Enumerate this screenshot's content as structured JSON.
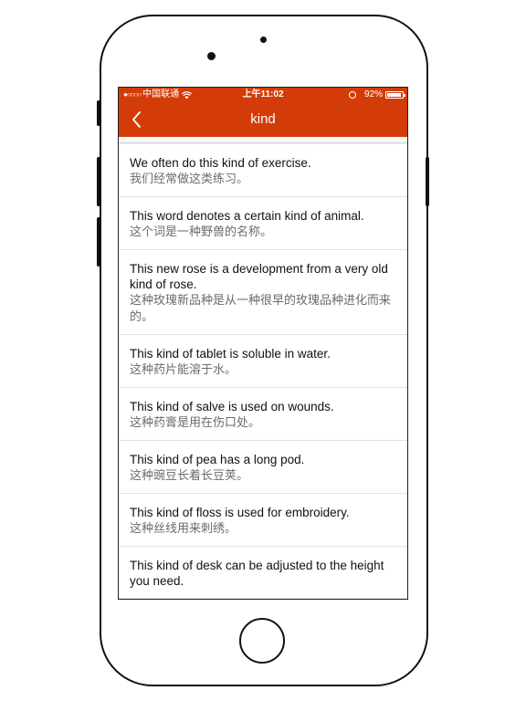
{
  "status_bar": {
    "signal": "●○○○○",
    "carrier": "中国联通",
    "wifi_icon": "wifi-icon",
    "time": "上午11:02",
    "battery": "92%"
  },
  "navbar": {
    "title": "kind",
    "back_icon": "chevron-left-icon"
  },
  "sentences": [
    {
      "en": "We often do this kind of exercise.",
      "zh": "我们经常做这类练习。"
    },
    {
      "en": "This word denotes a certain kind of animal.",
      "zh": "这个词是一种野兽的名称。"
    },
    {
      "en": "This new rose is a development from a very old kind of rose.",
      "zh": "这种玫瑰新品种是从一种很早的玫瑰品种进化而来的。"
    },
    {
      "en": "This kind of tablet is soluble in water.",
      "zh": "这种药片能溶于水。"
    },
    {
      "en": "This kind of salve is used on wounds.",
      "zh": "这种药膏是用在伤口处。"
    },
    {
      "en": "This kind of pea has a long pod.",
      "zh": "这种豌豆长着长豆荚。"
    },
    {
      "en": "This kind of floss is used for embroidery.",
      "zh": "这种丝线用来刺绣。"
    },
    {
      "en": "This kind of desk can be adjusted to the height you need.",
      "zh": ""
    }
  ],
  "colors": {
    "accent": "#d33c08"
  }
}
